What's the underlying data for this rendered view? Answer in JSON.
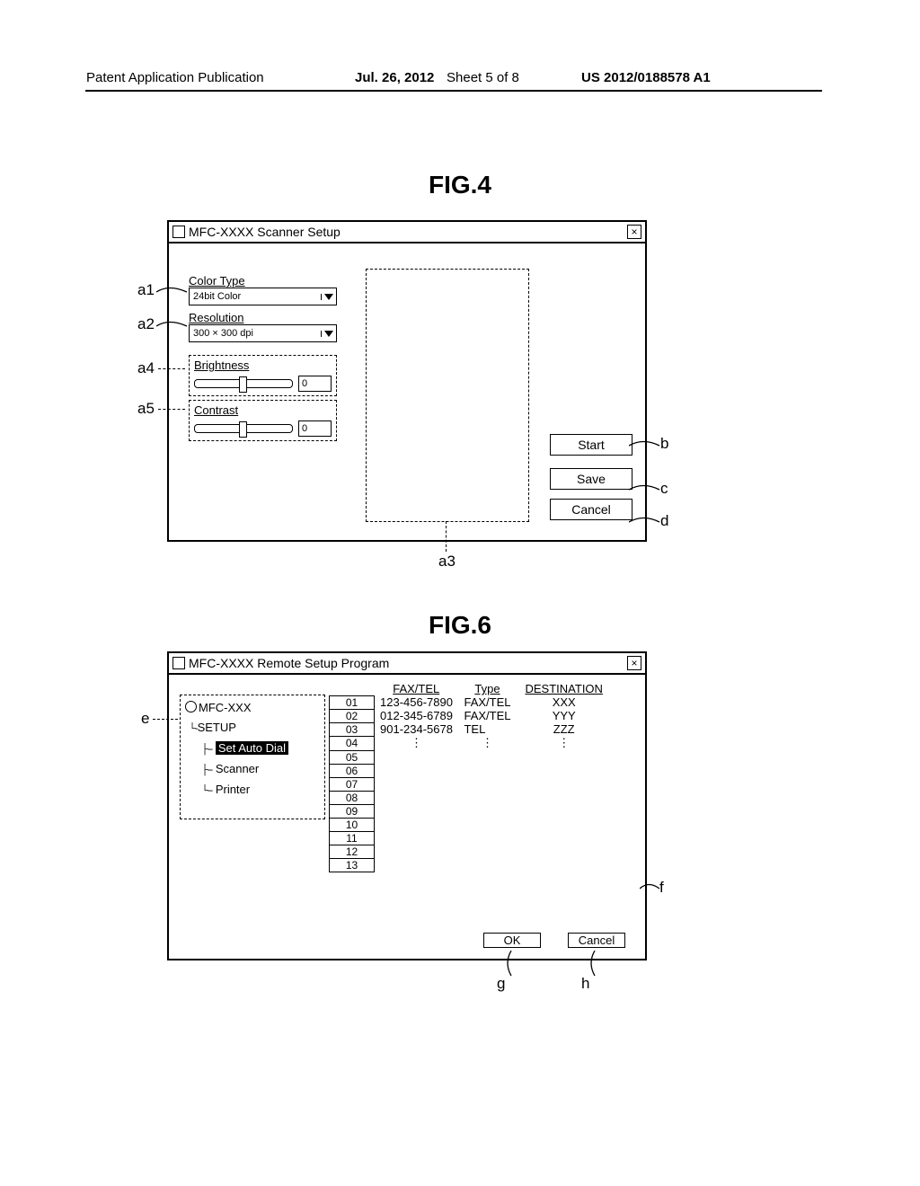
{
  "header": {
    "pub": "Patent Application Publication",
    "date": "Jul. 26, 2012",
    "sheet": "Sheet 5 of 8",
    "num": "US 2012/0188578 A1"
  },
  "fig4_label": "FIG.4",
  "fig6_label": "FIG.6",
  "win4": {
    "title": "MFC-XXXX  Scanner Setup",
    "color_type_label": "Color Type",
    "color_type_value": "24bit Color",
    "resolution_label": "Resolution",
    "resolution_value": "300 × 300 dpi",
    "brightness_label": "Brightness",
    "brightness_value": "0",
    "contrast_label": "Contrast",
    "contrast_value": "0",
    "btn_start": "Start",
    "btn_save": "Save",
    "btn_cancel": "Cancel"
  },
  "callouts4": {
    "a1": "a1",
    "a2": "a2",
    "a3": "a3",
    "a4": "a4",
    "a5": "a5",
    "b": "b",
    "c": "c",
    "d": "d"
  },
  "win6": {
    "title": "MFC-XXXX  Remote Setup Program",
    "tree_root": "MFC-XXX",
    "tree_setup": "SETUP",
    "tree_auto": "Set Auto Dial",
    "tree_scanner": "Scanner",
    "tree_printer": "Printer",
    "headers": {
      "faxtel": "FAX/TEL",
      "type": "Type",
      "dest": "DESTINATION"
    },
    "rows": [
      {
        "idx": "01",
        "num": "123-456-7890",
        "type": "FAX/TEL",
        "dest": "XXX"
      },
      {
        "idx": "02",
        "num": "012-345-6789",
        "type": "FAX/TEL",
        "dest": "YYY"
      },
      {
        "idx": "03",
        "num": "901-234-5678",
        "type": "TEL",
        "dest": "ZZZ"
      },
      {
        "idx": "04",
        "num": "⋮",
        "type": "⋮",
        "dest": "⋮"
      },
      {
        "idx": "05",
        "num": "",
        "type": "",
        "dest": ""
      },
      {
        "idx": "06",
        "num": "",
        "type": "",
        "dest": ""
      },
      {
        "idx": "07",
        "num": "",
        "type": "",
        "dest": ""
      },
      {
        "idx": "08",
        "num": "",
        "type": "",
        "dest": ""
      },
      {
        "idx": "09",
        "num": "",
        "type": "",
        "dest": ""
      },
      {
        "idx": "10",
        "num": "",
        "type": "",
        "dest": ""
      },
      {
        "idx": "11",
        "num": "",
        "type": "",
        "dest": ""
      },
      {
        "idx": "12",
        "num": "",
        "type": "",
        "dest": ""
      },
      {
        "idx": "13",
        "num": "",
        "type": "",
        "dest": ""
      }
    ],
    "btn_ok": "OK",
    "btn_cancel": "Cancel"
  },
  "callouts6": {
    "e": "e",
    "f": "f",
    "g": "g",
    "h": "h"
  }
}
